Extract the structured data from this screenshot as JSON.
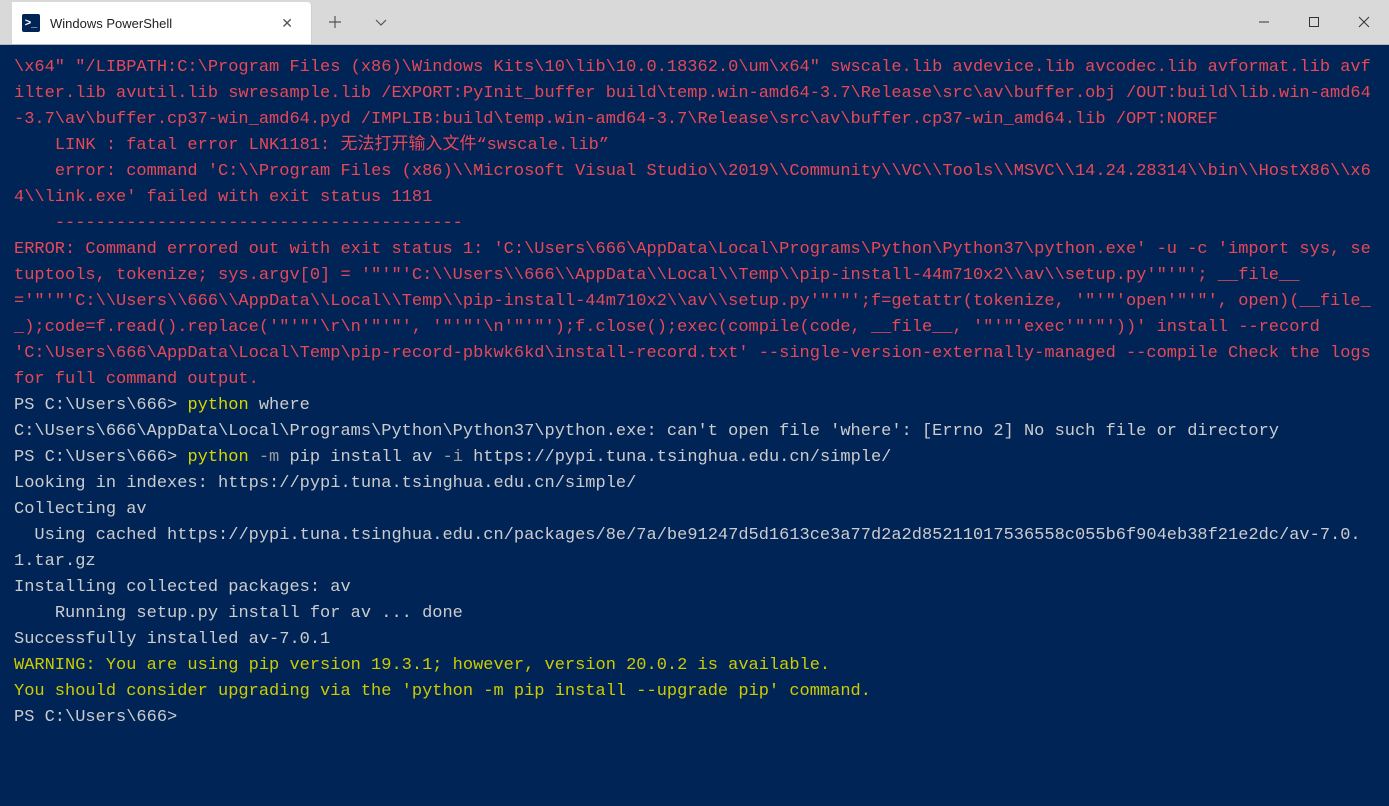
{
  "window": {
    "tab_title": "Windows PowerShell"
  },
  "term": {
    "err_block1": "\\x64\" \"/LIBPATH:C:\\Program Files (x86)\\Windows Kits\\10\\lib\\10.0.18362.0\\um\\x64\" swscale.lib avdevice.lib avcodec.lib avformat.lib avfilter.lib avutil.lib swresample.lib /EXPORT:PyInit_buffer build\\temp.win-amd64-3.7\\Release\\src\\av\\buffer.obj /OUT:build\\lib.win-amd64-3.7\\av\\buffer.cp37-win_amd64.pyd /IMPLIB:build\\temp.win-amd64-3.7\\Release\\src\\av\\buffer.cp37-win_amd64.lib /OPT:NOREF",
    "err_link": "    LINK : fatal error LNK1181: 无法打开输入文件“swscale.lib”",
    "err_cmd": "    error: command 'C:\\\\Program Files (x86)\\\\Microsoft Visual Studio\\\\2019\\\\Community\\\\VC\\\\Tools\\\\MSVC\\\\14.24.28314\\\\bin\\\\HostX86\\\\x64\\\\link.exe' failed with exit status 1181",
    "err_sep": "    ----------------------------------------",
    "err_final": "ERROR: Command errored out with exit status 1: 'C:\\Users\\666\\AppData\\Local\\Programs\\Python\\Python37\\python.exe' -u -c 'import sys, setuptools, tokenize; sys.argv[0] = '\"'\"'C:\\\\Users\\\\666\\\\AppData\\\\Local\\\\Temp\\\\pip-install-44m710x2\\\\av\\\\setup.py'\"'\"'; __file__='\"'\"'C:\\\\Users\\\\666\\\\AppData\\\\Local\\\\Temp\\\\pip-install-44m710x2\\\\av\\\\setup.py'\"'\"';f=getattr(tokenize, '\"'\"'open'\"'\"', open)(__file__);code=f.read().replace('\"'\"'\\r\\n'\"'\"', '\"'\"'\\n'\"'\"');f.close();exec(compile(code, __file__, '\"'\"'exec'\"'\"'))' install --record 'C:\\Users\\666\\AppData\\Local\\Temp\\pip-record-pbkwk6kd\\install-record.txt' --single-version-externally-managed --compile Check the logs for full command output.",
    "prompt1_pre": "PS C:\\Users\\666> ",
    "prompt1_kw": "python",
    "prompt1_rest": " where",
    "where_out": "C:\\Users\\666\\AppData\\Local\\Programs\\Python\\Python37\\python.exe: can't open file 'where': [Errno 2] No such file or directory",
    "prompt2_pre": "PS C:\\Users\\666> ",
    "prompt2_kw": "python",
    "prompt2_flag": " -m",
    "prompt2_mid": " pip install av ",
    "prompt2_flag2": "-i",
    "prompt2_url": " https://pypi.tuna.tsinghua.edu.cn/simple/",
    "pip_look": "Looking in indexes: https://pypi.tuna.tsinghua.edu.cn/simple/",
    "pip_coll": "Collecting av",
    "pip_cache": "  Using cached https://pypi.tuna.tsinghua.edu.cn/packages/8e/7a/be91247d5d1613ce3a77d2a2d85211017536558c055b6f904eb38f21e2dc/av-7.0.1.tar.gz",
    "pip_inst": "Installing collected packages: av",
    "pip_run": "    Running setup.py install for av ... done",
    "pip_ok": "Successfully installed av-7.0.1",
    "warn1": "WARNING: You are using pip version 19.3.1; however, version 20.0.2 is available.",
    "warn2": "You should consider upgrading via the 'python -m pip install --upgrade pip' command.",
    "prompt3": "PS C:\\Users\\666>"
  }
}
